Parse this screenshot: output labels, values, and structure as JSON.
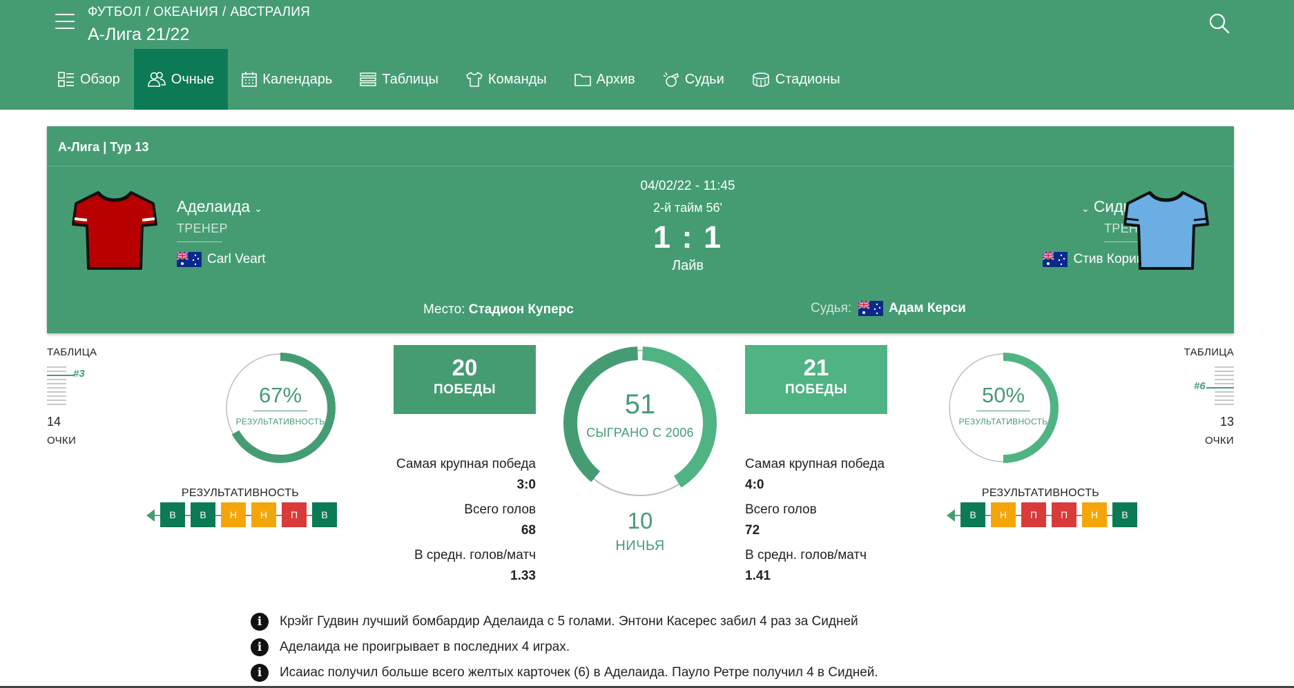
{
  "header": {
    "breadcrumb": [
      "ФУТБОЛ",
      "ОКЕАНИЯ",
      "АВСТРАЛИЯ"
    ],
    "breadcrumb_sep": "/",
    "title": "А-Лига 21/22"
  },
  "nav": [
    {
      "label": "Обзор",
      "icon": "overview-icon"
    },
    {
      "label": "Очные",
      "icon": "head-to-head-icon",
      "active": true
    },
    {
      "label": "Календарь",
      "icon": "calendar-icon"
    },
    {
      "label": "Таблицы",
      "icon": "tables-icon"
    },
    {
      "label": "Команды",
      "icon": "shirt-icon"
    },
    {
      "label": "Архив",
      "icon": "folder-icon"
    },
    {
      "label": "Судьи",
      "icon": "whistle-icon"
    },
    {
      "label": "Стадионы",
      "icon": "stadium-icon"
    }
  ],
  "match": {
    "round": "А-Лига | Тур 13",
    "datetime": "04/02/22 - 11:45",
    "period": "2-й тайм  56'",
    "score": "1 : 1",
    "status": "Лайв",
    "venue_label": "Место:",
    "venue": "Стадион Куперс",
    "referee_label": "Судья:",
    "referee": "Адам Керси",
    "home": {
      "name": "Аделаида",
      "coach_label": "ТРЕНЕР",
      "coach": "Carl Veart",
      "shirt_color": "#b90000"
    },
    "away": {
      "name": "Сидней",
      "coach_label": "ТРЕНЕР",
      "coach": "Стив Корика",
      "shirt_color": "#6aaee3"
    }
  },
  "home_stats": {
    "table_label": "ТАБЛИЦА",
    "position": "#3",
    "points": "14",
    "points_label": "ОЧКИ",
    "efficiency_pct": "67%",
    "efficiency_value": 0.67,
    "efficiency_label": "РЕЗУЛЬТАТИВНОСТЬ",
    "form_label": "РЕЗУЛЬТАТИВНОСТЬ",
    "form": [
      "В",
      "В",
      "Н",
      "Н",
      "П",
      "В"
    ],
    "wins": "20",
    "wins_label": "ПОБЕДЫ",
    "biggest_win_label": "Самая крупная победа",
    "biggest_win": "3:0",
    "total_goals_label": "Всего голов",
    "total_goals": "68",
    "avg_goals_label": "В средн. голов/матч",
    "avg_goals": "1.33"
  },
  "away_stats": {
    "table_label": "ТАБЛИЦА",
    "position": "#6",
    "points": "13",
    "points_label": "ОЧКИ",
    "efficiency_pct": "50%",
    "efficiency_value": 0.5,
    "efficiency_label": "РЕЗУЛЬТАТИВНОСТЬ",
    "form_label": "РЕЗУЛЬТАТИВНОСТЬ",
    "form": [
      "В",
      "Н",
      "П",
      "П",
      "Н",
      "В"
    ],
    "wins": "21",
    "wins_label": "ПОБЕДЫ",
    "biggest_win_label": "Самая крупная победа",
    "biggest_win": "4:0",
    "total_goals_label": "Всего голов",
    "total_goals": "72",
    "avg_goals_label": "В средн. голов/матч",
    "avg_goals": "1.41"
  },
  "h2h": {
    "played": "51",
    "played_label": "СЫГРАНО С 2006",
    "draws": "10",
    "draws_label": "НИЧЬЯ",
    "home_wins": 20,
    "away_wins": 21,
    "draw_count": 10
  },
  "facts": [
    "Крэйг Гудвин лучший бомбардир Аделаида с 5 голами. Энтони Касерес забил 4 раз за Сидней",
    "Аделаида не проигрывает в последних 4 играх.",
    "Исаиас получил больше всего желтых карточек (6) в Аделаида. Пауло Ретре получил 4 в Сидней."
  ],
  "colors": {
    "primary": "#459c73",
    "primary_dark": "#0d7a56",
    "win": "#0d7a56",
    "draw": "#f3a60b",
    "loss": "#d93a3a",
    "away_accent": "#4fb383"
  }
}
